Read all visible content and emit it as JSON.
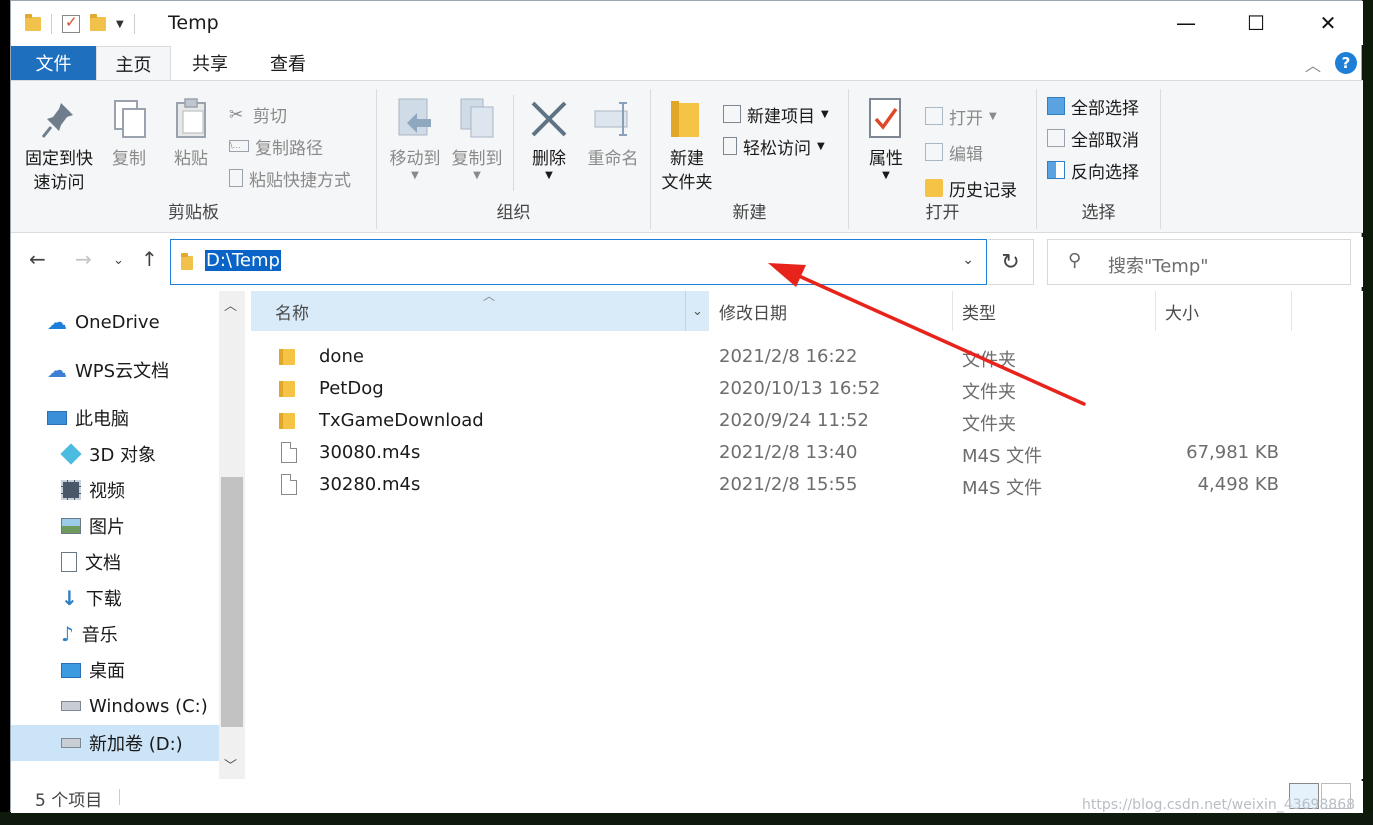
{
  "window": {
    "title": "Temp",
    "minimize_glyph": "—",
    "maximize_glyph": "☐",
    "close_glyph": "✕"
  },
  "tabs": {
    "file": "文件",
    "home": "主页",
    "share": "共享",
    "view": "查看"
  },
  "ribbon": {
    "clipboard": {
      "label": "剪贴板",
      "pin_line1": "固定到快",
      "pin_line2": "速访问",
      "copy": "复制",
      "paste": "粘贴",
      "cut": "剪切",
      "copy_path": "复制路径",
      "paste_shortcut": "粘贴快捷方式"
    },
    "organize": {
      "label": "组织",
      "move_to": "移动到",
      "copy_to": "复制到",
      "delete": "删除",
      "rename": "重命名"
    },
    "new": {
      "label": "新建",
      "new_folder_line1": "新建",
      "new_folder_line2": "文件夹",
      "new_item": "新建项目",
      "easy_access": "轻松访问"
    },
    "open": {
      "label": "打开",
      "properties": "属性",
      "open": "打开",
      "edit": "编辑",
      "history": "历史记录"
    },
    "select": {
      "label": "选择",
      "select_all": "全部选择",
      "select_none": "全部取消",
      "invert": "反向选择"
    }
  },
  "address": {
    "path": "D:\\Temp",
    "search_placeholder": "搜索\"Temp\""
  },
  "nav": {
    "items": [
      {
        "label": "OneDrive"
      },
      {
        "label": "WPS云文档"
      },
      {
        "label": "此电脑"
      },
      {
        "label": "3D 对象"
      },
      {
        "label": "视频"
      },
      {
        "label": "图片"
      },
      {
        "label": "文档"
      },
      {
        "label": "下载"
      },
      {
        "label": "音乐"
      },
      {
        "label": "桌面"
      },
      {
        "label": "Windows (C:)"
      },
      {
        "label": "新加卷 (D:)"
      }
    ]
  },
  "columns": {
    "name": "名称",
    "date": "修改日期",
    "type": "类型",
    "size": "大小"
  },
  "files": [
    {
      "name": "done",
      "date": "2021/2/8 16:22",
      "type": "文件夹",
      "size": ""
    },
    {
      "name": "PetDog",
      "date": "2020/10/13 16:52",
      "type": "文件夹",
      "size": ""
    },
    {
      "name": "TxGameDownload",
      "date": "2020/9/24 11:52",
      "type": "文件夹",
      "size": ""
    },
    {
      "name": "30080.m4s",
      "date": "2021/2/8 13:40",
      "type": "M4S 文件",
      "size": "67,981 KB"
    },
    {
      "name": "30280.m4s",
      "date": "2021/2/8 15:55",
      "type": "M4S 文件",
      "size": "4,498 KB"
    }
  ],
  "status": {
    "count": "5 个项目"
  },
  "watermark": "https://blog.csdn.net/weixin_43698868",
  "colors": {
    "accent": "#1e6fbe",
    "selection": "#0a64c8",
    "annotation_arrow": "#e8231b"
  }
}
